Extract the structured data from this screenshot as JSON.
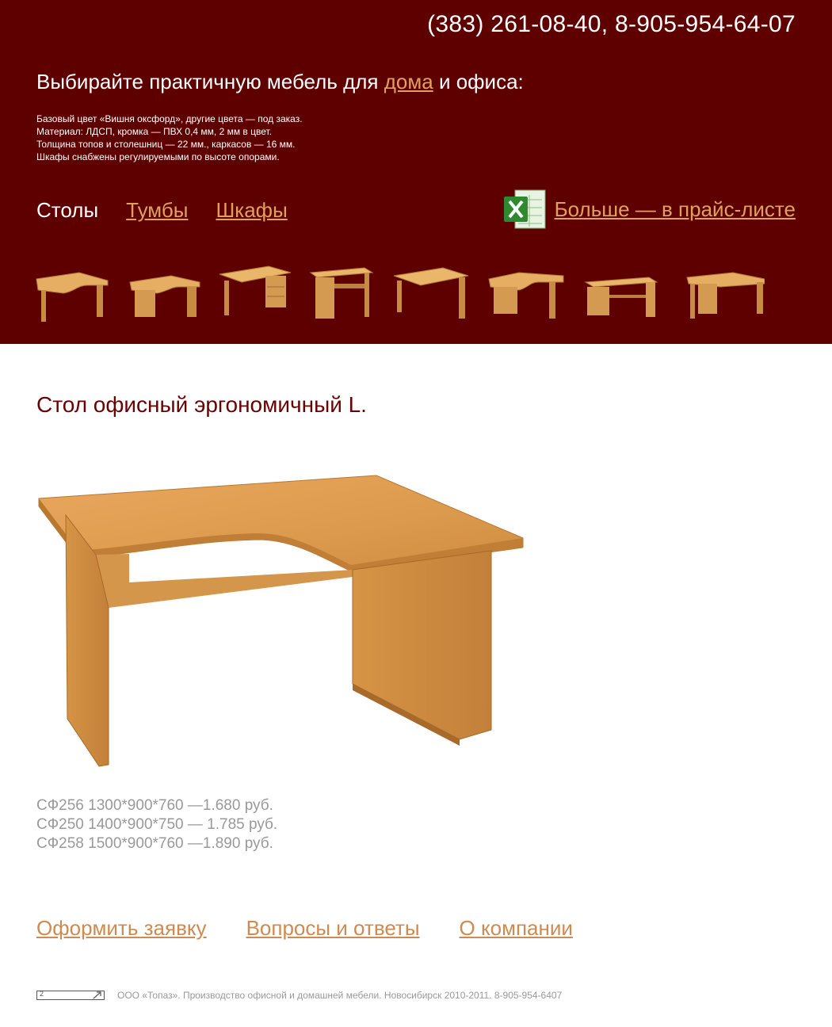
{
  "header": {
    "phone": "(383) 261-08-40, 8-905-954-64-07",
    "headline_before": "Выбирайте практичную мебель для ",
    "headline_link": "дома",
    "headline_after": " и офиса:",
    "specs": [
      "Базовый цвет «Вишня оксфорд», другие цвета — под заказ.",
      "Материал: ЛДСП, кромка — ПВХ 0,4 мм, 2 мм в цвет.",
      "Толщина топов и столешниц — 22 мм., каркасов — 16 мм.",
      "Шкафы снабжены регулируемыми по высоте опорами."
    ],
    "nav": {
      "tables": "Столы",
      "nightstands": "Тумбы",
      "cabinets": "Шкафы"
    },
    "pricelist_label": "Больше — в прайс-листе",
    "pricelist_icon": "excel-icon",
    "thumbnail_icon": "desk-thumbnail-icon"
  },
  "product": {
    "title": "Стол офисный эргономичный L.",
    "image_icon": "corner-desk-image",
    "prices": [
      "СФ256 1300*900*760 —1.680 руб.",
      "СФ250 1400*900*750 — 1.785 руб.",
      "СФ258 1500*900*760 —1.890 руб."
    ]
  },
  "footer": {
    "links": {
      "order": "Оформить заявку",
      "faq": "Вопросы и ответы",
      "about": "О компании"
    },
    "copyright": "ООО «Топаз». Производство офисной и домашней мебели. Новосибирск 2010-2011. 8-905-954-6407",
    "badge_text": "2"
  },
  "colors": {
    "header_bg": "#5e0000",
    "link": "#e0a060",
    "title": "#6b0000",
    "wood": "#d9a050"
  }
}
